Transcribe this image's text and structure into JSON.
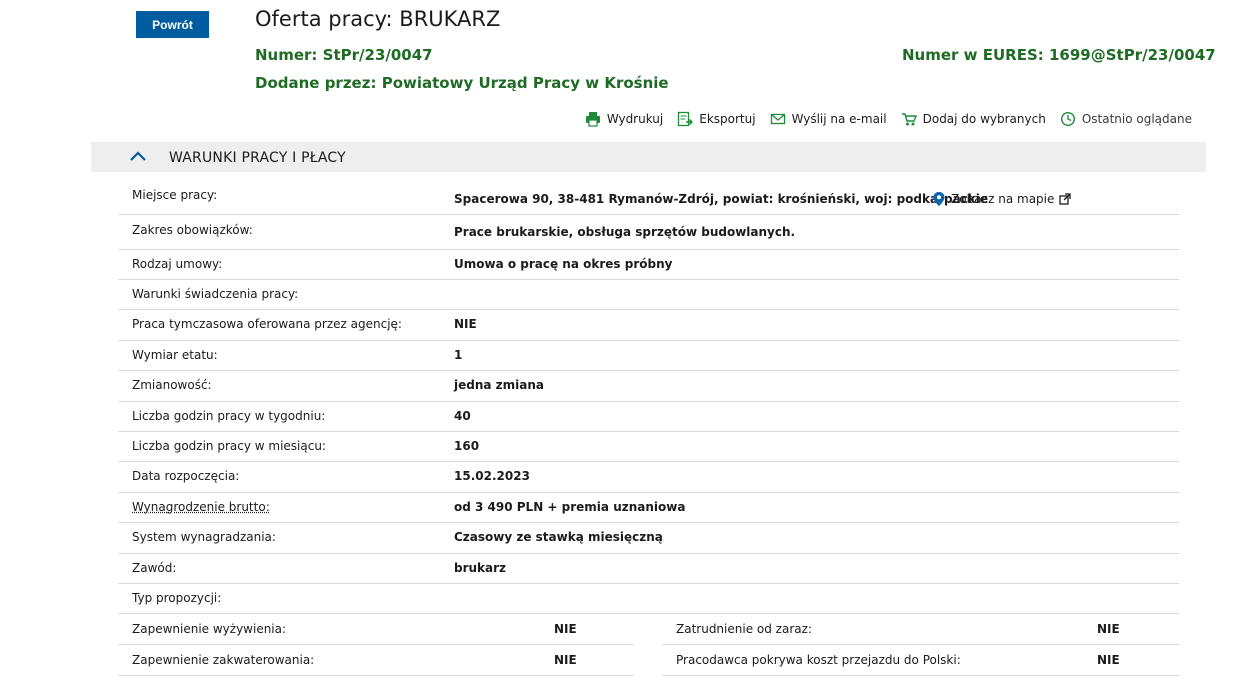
{
  "header": {
    "back_label": "Powrót",
    "title": "Oferta pracy: BRUKARZ",
    "numer_label": "Numer:",
    "numer_value": "StPr/23/0047",
    "eures_label": "Numer w EURES:",
    "eures_value": "1699@StPr/23/0047",
    "dodane_label": "Dodane przez:",
    "dodane_value": "Powiatowy Urząd Pracy w Krośnie"
  },
  "toolbar": {
    "print": "Wydrukuj",
    "export": "Eksportuj",
    "email": "Wyślij na e-mail",
    "favorites": "Dodaj do wybranych",
    "recent": "Ostatnio oglądane"
  },
  "section": {
    "title": "WARUNKI PRACY I PŁACY"
  },
  "rows": [
    {
      "label": "Miejsce pracy:",
      "value": "Spacerowa 90, 38-481 Rymanów-Zdrój, powiat: krośnieński, woj: podkarpackie"
    },
    {
      "label": "Zakres obowiązków:",
      "value": "Prace brukarskie, obsługa sprzętów budowlanych."
    },
    {
      "label": "Rodzaj umowy:",
      "value": "Umowa o pracę na okres próbny"
    },
    {
      "label": "Warunki świadczenia pracy:",
      "value": ""
    },
    {
      "label": "Praca tymczasowa oferowana przez agencję:",
      "value": "NIE"
    },
    {
      "label": "Wymiar etatu:",
      "value": "1"
    },
    {
      "label": "Zmianowość:",
      "value": "jedna zmiana"
    },
    {
      "label": "Liczba godzin pracy w tygodniu:",
      "value": "40"
    },
    {
      "label": "Liczba godzin pracy w miesiącu:",
      "value": "160"
    },
    {
      "label": "Data rozpoczęcia:",
      "value": "15.02.2023"
    },
    {
      "label": "Wynagrodzenie brutto:",
      "value": "od 3 490 PLN + premia uznaniowa"
    },
    {
      "label": "System wynagradzania:",
      "value": "Czasowy ze stawką miesięczną"
    },
    {
      "label": "Zawód:",
      "value": "brukarz"
    },
    {
      "label": "Typ propozycji:",
      "value": ""
    }
  ],
  "map_link": "Zobacz na mapie",
  "pairs": [
    {
      "left_label": "Zapewnienie wyżywienia:",
      "left_value": "NIE",
      "right_label": "Zatrudnienie od zaraz:",
      "right_value": "NIE"
    },
    {
      "left_label": "Zapewnienie zakwaterowania:",
      "left_value": "NIE",
      "right_label": "Pracodawca pokrywa koszt przejazdu do Polski:",
      "right_value": "NIE"
    }
  ],
  "colors": {
    "brand_blue": "#005ca1",
    "green": "#1f6b25",
    "section_bg": "#eeeeee"
  }
}
